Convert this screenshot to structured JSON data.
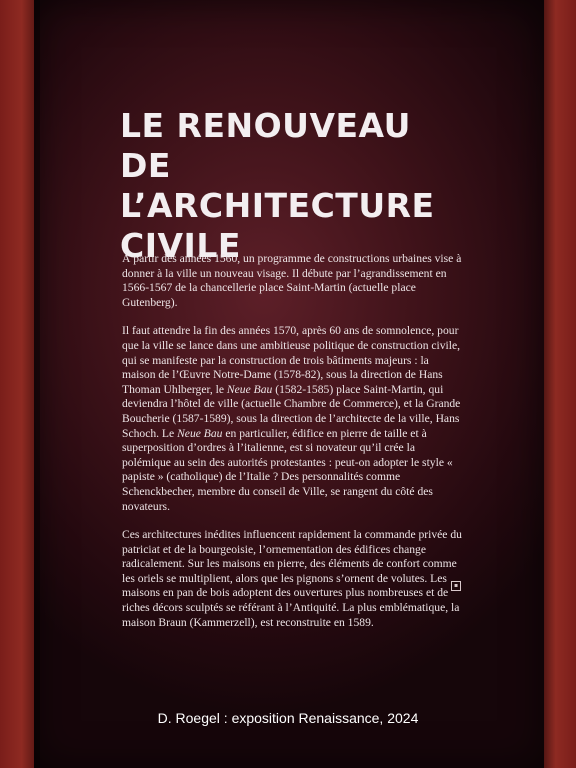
{
  "panel": {
    "title_lines": [
      "LE RENOUVEAU",
      "DE L’ARCHITECTURE",
      "CIVILE"
    ],
    "paragraph1": "À partir des années 1560, un programme de constructions urbaines vise à donner à la ville un nouveau visage. Il débute par l’agrandissement en 1566-1567 de la chancellerie place Saint-Martin (actuelle place Gutenberg).",
    "paragraph2": {
      "part1": "Il faut attendre la fin des années 1570, après 60 ans de somnolence, pour que la ville se lance dans une ambitieuse politique de construction civile, qui se manifeste par la construction de trois bâtiments majeurs : la maison de l’Œuvre Notre-Dame (1578-82), sous la direction de Hans Thoman Uhlberger, le ",
      "italic1": "Neue Bau",
      "part2": " (1582-1585) place Saint-Martin, qui deviendra l’hôtel de ville (actuelle Chambre de Commerce), et la Grande Boucherie (1587-1589), sous la direction de l’architecte de la ville, Hans Schoch. Le ",
      "italic2": "Neue Bau",
      "part3": " en particulier, édifice en pierre de taille et à superposition d’ordres à l’italienne, est si novateur qu’il crée la polémique au sein des autorités protestantes : peut-on adopter le style « papiste » (catholique) de l’Italie ? Des personnalités comme Schenckbecher, membre du conseil de Ville, se rangent du côté des novateurs."
    },
    "paragraph3": "Ces architectures inédites influencent rapidement la commande privée du patriciat et de la bourgeoisie, l’ornementation des édifices change radicalement. Sur les maisons en pierre, des éléments de confort comme les oriels se multiplient, alors que les pignons s’ornent de volutes. Les maisons en pan de bois adoptent des ouvertures plus nombreuses et de riches décors sculptés se référant à l’Antiquité. La plus emblématique, la maison Braun (Kammerzell), est reconstruite en 1589.",
    "marker_icon": "end-square-icon"
  },
  "caption": "D. Roegel : exposition Renaissance, 2024",
  "colors": {
    "panel_center": "#5d1f28",
    "panel_edge": "#16060a",
    "wall": "#8e2a22",
    "text": "#ede4e6"
  }
}
